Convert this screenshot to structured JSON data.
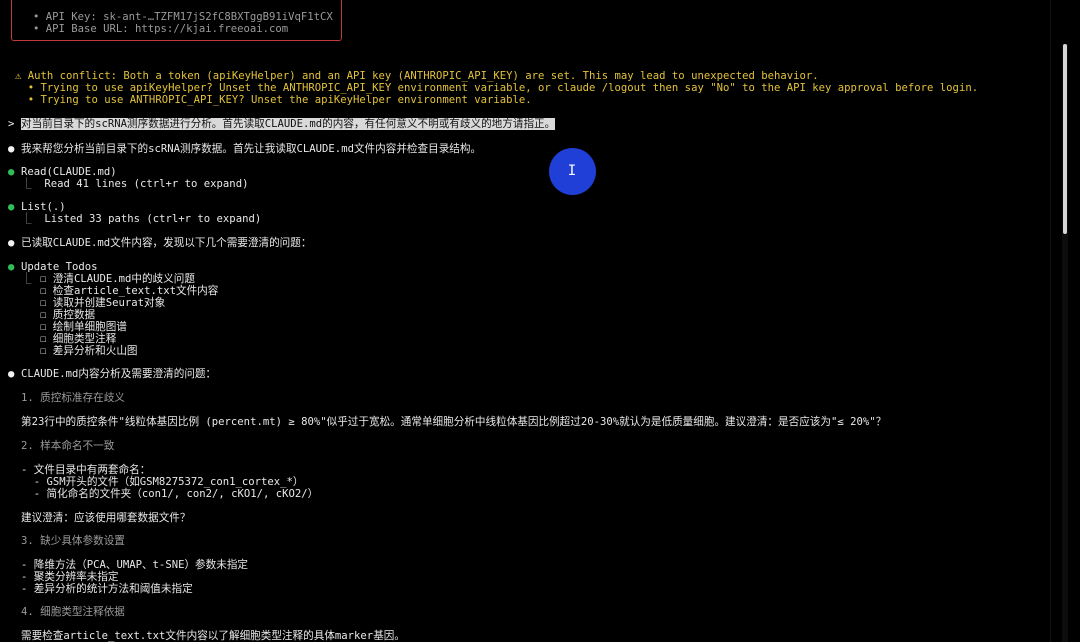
{
  "config_box": {
    "api_key_line": "• API Key: sk-ant-…TZFM17jS2fC8BXTggB91iVqF1tCX",
    "base_url_line": "• API Base URL: https://kjai.freeoai.com"
  },
  "warning": {
    "title": "⚠ Auth conflict: Both a token (apiKeyHelper) and an API key (ANTHROPIC_API_KEY) are set. This may lead to unexpected behavior.",
    "hint1": "  • Trying to use apiKeyHelper? Unset the ANTHROPIC_API_KEY environment variable, or claude /logout then say \"No\" to the API key approval before login.",
    "hint2": "  • Trying to use ANTHROPIC_API_KEY? Unset the apiKeyHelper environment variable."
  },
  "user_prompt": {
    "marker": ">",
    "text": "对当前目录下的scRNA测序数据进行分析。首先读取CLAUDE.md的内容，有任何意义不明或有歧义的地方请指正。"
  },
  "assistant": {
    "intro": "我来帮您分析当前目录下的scRNA测序数据。首先让我读取CLAUDE.md文件内容并检查目录结构。",
    "tool_read": {
      "name": "Read(CLAUDE.md)",
      "result": "  Read 41 lines (ctrl+r to expand)"
    },
    "tool_list": {
      "name": "List(.)",
      "result": "  Listed 33 paths (ctrl+r to expand)"
    },
    "read_summary": "已读取CLAUDE.md文件内容，发现以下几个需要澄清的问题：",
    "todos_title": "Update Todos",
    "todos": [
      "☐ 澄清CLAUDE.md中的歧义问题",
      "☐ 检查article_text.txt文件内容",
      "☐ 读取并创建Seurat对象",
      "☐ 质控数据",
      "☐ 绘制单细胞图谱",
      "☐ 细胞类型注释",
      "☐ 差异分析和火山图"
    ],
    "analysis_title": "CLAUDE.md内容分析及需要澄清的问题：",
    "s1_heading": "1. 质控标准存在歧义",
    "s1_body": "第23行中的质控条件\"线粒体基因比例 (percent.mt) ≥ 80%\"似乎过于宽松。通常单细胞分析中线粒体基因比例超过20-30%就认为是低质量细胞。建议澄清：是否应该为\"≤ 20%\"？",
    "s2_heading": "2. 样本命名不一致",
    "s2_l1": "- 文件目录中有两套命名：",
    "s2_l2": "  - GSM开头的文件（如GSM8275372_con1_cortex_*）",
    "s2_l3": "  - 简化命名的文件夹（con1/, con2/, cKO1/, cKO2/）",
    "s2_q": "建议澄清：应该使用哪套数据文件？",
    "s3_heading": "3. 缺少具体参数设置",
    "s3_l1": "- 降维方法（PCA、UMAP、t-SNE）参数未指定",
    "s3_l2": "- 聚类分辨率未指定",
    "s3_l3": "- 差异分析的统计方法和阈值未指定",
    "s4_heading": "4. 细胞类型注释依据",
    "s4_body": "需要检查article_text.txt文件内容以了解细胞类型注释的具体marker基因。"
  },
  "symbols": {
    "bullet": "●",
    "branch": "⎿"
  },
  "colors": {
    "success": "#2fbf56",
    "warning": "#e2c23a",
    "cursor": "#1f3fd6"
  }
}
